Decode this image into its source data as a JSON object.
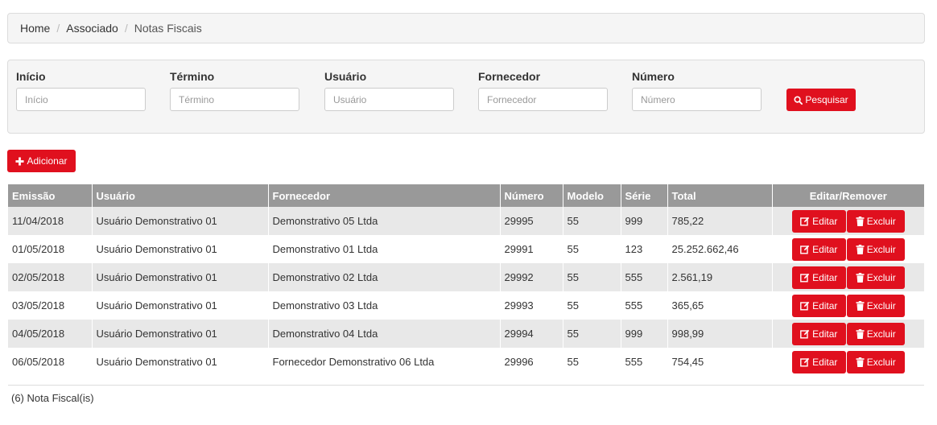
{
  "breadcrumb": {
    "items": [
      "Home",
      "Associado"
    ],
    "active": "Notas Fiscais",
    "separator": "/"
  },
  "filters": {
    "inicio": {
      "label": "Início",
      "placeholder": "Início",
      "value": ""
    },
    "termino": {
      "label": "Término",
      "placeholder": "Término",
      "value": ""
    },
    "usuario": {
      "label": "Usuário",
      "placeholder": "Usuário",
      "value": ""
    },
    "fornecedor": {
      "label": "Fornecedor",
      "placeholder": "Fornecedor",
      "value": ""
    },
    "numero": {
      "label": "Número",
      "placeholder": "Número",
      "value": ""
    },
    "search_label": "Pesquisar"
  },
  "add_label": "Adicionar",
  "table": {
    "columns": [
      "Emissão",
      "Usuário",
      "Fornecedor",
      "Número",
      "Modelo",
      "Série",
      "Total",
      "Editar/Remover"
    ],
    "rows": [
      [
        "11/04/2018",
        "Usuário Demonstrativo 01",
        "Demonstrativo 05 Ltda",
        "29995",
        "55",
        "999",
        "785,22"
      ],
      [
        "01/05/2018",
        "Usuário Demonstrativo 01",
        "Demonstrativo 01 Ltda",
        "29991",
        "55",
        "123",
        "25.252.662,46"
      ],
      [
        "02/05/2018",
        "Usuário Demonstrativo 01",
        "Demonstrativo 02 Ltda",
        "29992",
        "55",
        "555",
        "2.561,19"
      ],
      [
        "03/05/2018",
        "Usuário Demonstrativo 01",
        "Demonstrativo 03 Ltda",
        "29993",
        "55",
        "555",
        "365,65"
      ],
      [
        "04/05/2018",
        "Usuário Demonstrativo 01",
        "Demonstrativo 04 Ltda",
        "29994",
        "55",
        "999",
        "998,99"
      ],
      [
        "06/05/2018",
        "Usuário Demonstrativo 01",
        "Fornecedor Demonstrativo 06 Ltda",
        "29996",
        "55",
        "555",
        "754,45"
      ]
    ],
    "edit_label": "Editar",
    "delete_label": "Excluir"
  },
  "footer": {
    "count_text": "(6) Nota Fiscal(is)"
  },
  "colors": {
    "accent": "#e0101e",
    "header_bg": "#999999",
    "stripe": "#e8e8e8",
    "panel_bg": "#f5f5f5"
  },
  "icons": {
    "search": "search-icon",
    "add": "plus-icon",
    "edit": "edit-icon",
    "delete": "trash-icon"
  }
}
